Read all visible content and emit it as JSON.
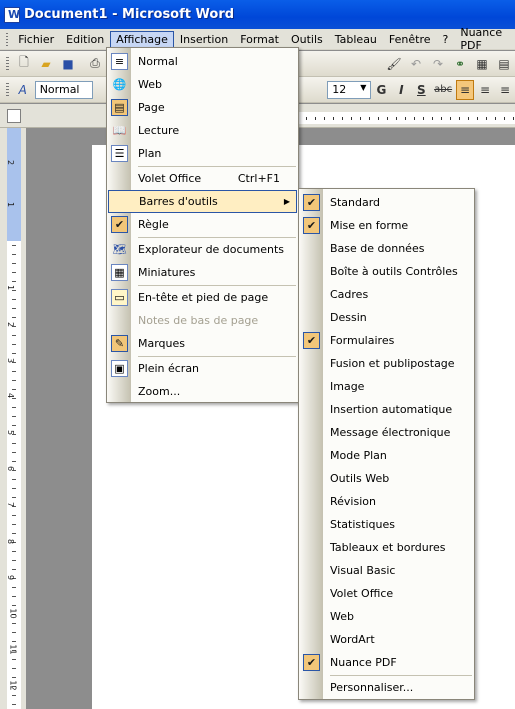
{
  "window": {
    "title": "Document1 - Microsoft Word"
  },
  "menubar": {
    "items": [
      "Fichier",
      "Edition",
      "Affichage",
      "Insertion",
      "Format",
      "Outils",
      "Tableau",
      "Fenêtre",
      "?",
      "Nuance PDF"
    ]
  },
  "formatting": {
    "style": "Normal",
    "size": "12",
    "bold": "G",
    "italic": "I",
    "underline": "S",
    "strike": "abc"
  },
  "view_menu": {
    "items": [
      {
        "label": "Normal",
        "icon": "normal-view-icon"
      },
      {
        "label": "Web",
        "icon": "web-view-icon"
      },
      {
        "label": "Page",
        "icon": "page-view-icon",
        "checked": true
      },
      {
        "label": "Lecture",
        "icon": "reading-view-icon"
      },
      {
        "label": "Plan",
        "icon": "outline-view-icon"
      },
      {
        "label": "Volet Office",
        "shortcut": "Ctrl+F1"
      },
      {
        "label": "Barres d'outils",
        "submenu": true
      },
      {
        "label": "Règle",
        "checked": true
      },
      {
        "label": "Explorateur de documents",
        "icon": "document-map-icon"
      },
      {
        "label": "Miniatures",
        "icon": "thumbnails-icon"
      },
      {
        "label": "En-tête et pied de page",
        "icon": "header-footer-icon"
      },
      {
        "label": "Notes de bas de page",
        "disabled": true
      },
      {
        "label": "Marques",
        "icon": "markup-icon",
        "checked": true
      },
      {
        "label": "Plein écran",
        "icon": "full-screen-icon"
      },
      {
        "label": "Zoom..."
      }
    ]
  },
  "toolbars_menu": {
    "items": [
      {
        "label": "Standard",
        "checked": true
      },
      {
        "label": "Mise en forme",
        "checked": true
      },
      {
        "label": "Base de données"
      },
      {
        "label": "Boîte à outils Contrôles"
      },
      {
        "label": "Cadres"
      },
      {
        "label": "Dessin"
      },
      {
        "label": "Formulaires",
        "checked": true
      },
      {
        "label": "Fusion et publipostage"
      },
      {
        "label": "Image"
      },
      {
        "label": "Insertion automatique"
      },
      {
        "label": "Message électronique"
      },
      {
        "label": "Mode Plan"
      },
      {
        "label": "Outils Web"
      },
      {
        "label": "Révision"
      },
      {
        "label": "Statistiques"
      },
      {
        "label": "Tableaux et bordures"
      },
      {
        "label": "Visual Basic"
      },
      {
        "label": "Volet Office"
      },
      {
        "label": "Web"
      },
      {
        "label": "WordArt"
      },
      {
        "label": "Nuance PDF",
        "checked": true
      },
      {
        "label": "Personnaliser..."
      }
    ]
  },
  "ruler": {
    "v_labels": [
      "2",
      "1",
      "1",
      "2",
      "3",
      "4",
      "5",
      "6",
      "7",
      "8",
      "9",
      "10",
      "11",
      "12"
    ]
  }
}
